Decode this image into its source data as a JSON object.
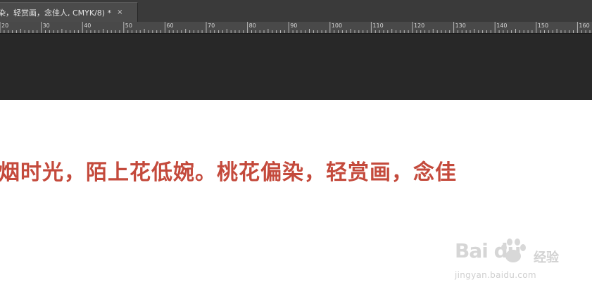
{
  "document_tab": {
    "title": "染，轻赏画，念佳人, CMYK/8) *",
    "close_symbol": "×"
  },
  "ruler": {
    "labels": [
      "20",
      "30",
      "40",
      "50",
      "60",
      "70",
      "80",
      "90",
      "100",
      "110",
      "120",
      "130",
      "140",
      "150",
      "160"
    ]
  },
  "canvas": {
    "text": "烟时光，陌上花低婉。桃花偏染，轻赏画，念佳",
    "text_color": "#c44a3c"
  },
  "watermark": {
    "logo": "Bai du",
    "product": "经验",
    "url": "jingyan.baidu.com"
  },
  "colors": {
    "tabbar_bg": "#3a3a3a",
    "tab_active_bg": "#4b4b4b",
    "ruler_bg": "#494949",
    "pasteboard_bg": "#282828",
    "canvas_bg": "#ffffff"
  }
}
